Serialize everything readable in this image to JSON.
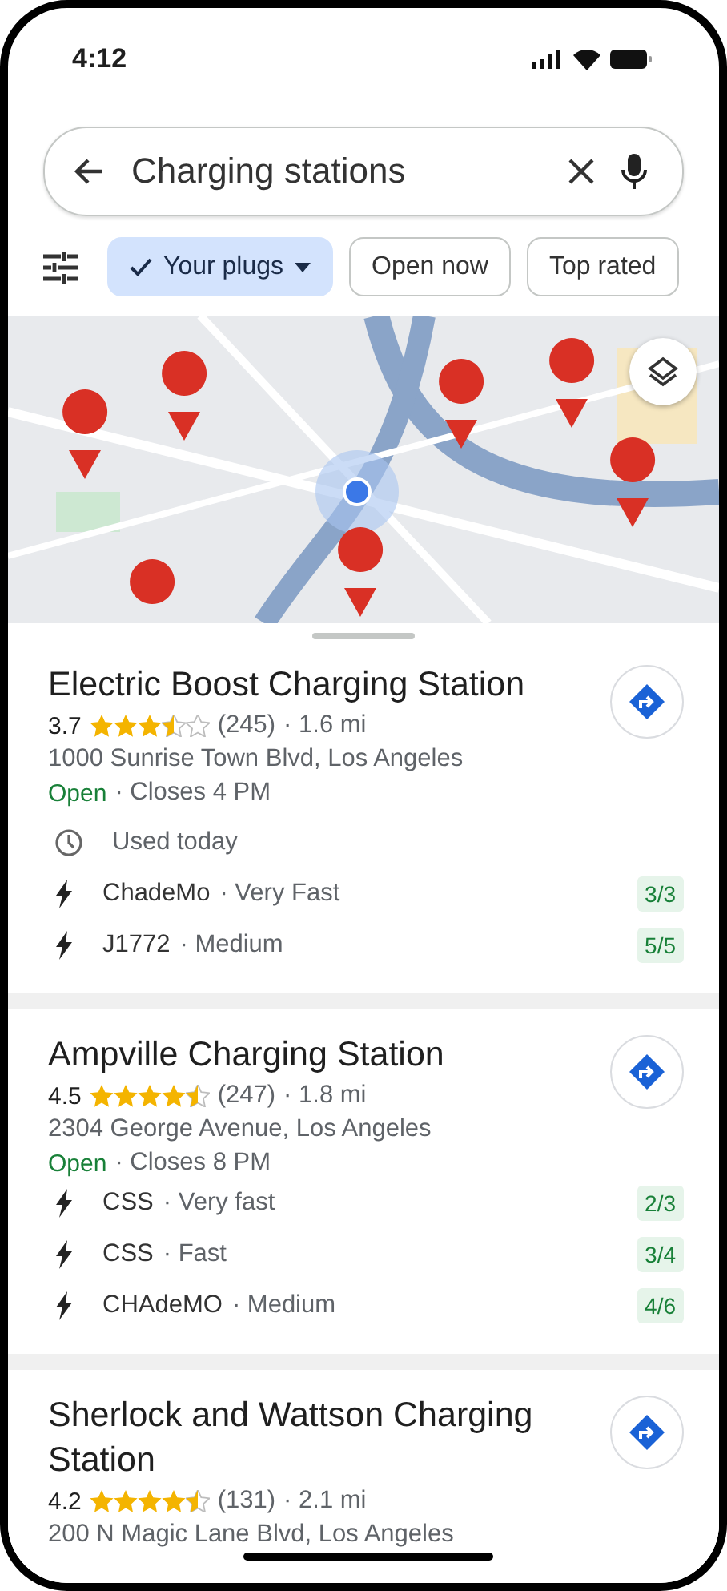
{
  "status_bar": {
    "time": "4:12"
  },
  "search": {
    "value": "Charging stations"
  },
  "chips": [
    {
      "label": "Your plugs",
      "selected": true,
      "dropdown": true
    },
    {
      "label": "Open now",
      "selected": false,
      "dropdown": false
    },
    {
      "label": "Top rated",
      "selected": false,
      "dropdown": false
    }
  ],
  "results": [
    {
      "name": "Electric Boost Charging Station",
      "rating": "3.7",
      "stars": 3.5,
      "reviews": "(245)",
      "distance": "· 1.6 mi",
      "address": "1000 Sunrise Town Blvd, Los Angeles",
      "status": "Open",
      "hours": "· Closes 4 PM",
      "note": "Used today",
      "plugs": [
        {
          "type": "ChadeMo",
          "speed": "· Very Fast",
          "available": "3/3"
        },
        {
          "type": "J1772",
          "speed": "· Medium",
          "available": "5/5"
        }
      ]
    },
    {
      "name": "Ampville Charging Station",
      "rating": "4.5",
      "stars": 4.5,
      "reviews": "(247)",
      "distance": "· 1.8 mi",
      "address": "2304 George Avenue, Los Angeles",
      "status": "Open",
      "hours": "· Closes 8 PM",
      "plugs": [
        {
          "type": "CSS",
          "speed": "· Very fast",
          "available": "2/3"
        },
        {
          "type": "CSS",
          "speed": "· Fast",
          "available": "3/4"
        },
        {
          "type": "CHAdeMO",
          "speed": "· Medium",
          "available": "4/6"
        }
      ]
    },
    {
      "name": "Sherlock and Wattson Charging Station",
      "rating": "4.2",
      "stars": 4.5,
      "reviews": "(131)",
      "distance": "· 2.1 mi",
      "address": "200 N Magic Lane Blvd, Los Angeles"
    }
  ]
}
